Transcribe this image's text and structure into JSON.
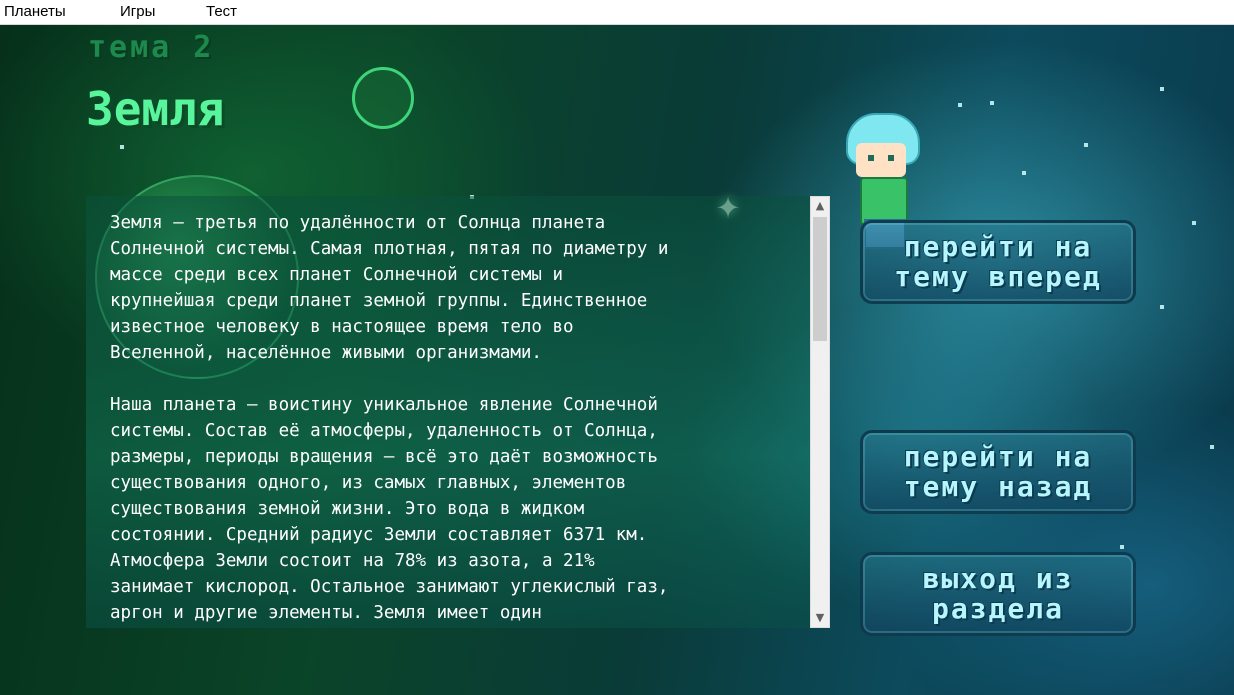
{
  "menu": {
    "items": [
      {
        "label": "Планеты"
      },
      {
        "label": "Игры"
      },
      {
        "label": "Тест"
      }
    ]
  },
  "header": {
    "topic_label": "тема 2",
    "title": "Земля"
  },
  "content": {
    "text": "Земля — третья по удалённости от Солнца планета\nСолнечной системы. Самая плотная, пятая по диаметру и\nмассе среди всех планет Солнечной системы и\nкрупнейшая среди планет земной группы. Единственное\nизвестное человеку в настоящее время тело во\nВселенной, населённое живыми организмами.\n\nНаша планета – воистину уникальное явление Солнечной\nсистемы. Состав её атмосферы, удаленность от Солнца,\nразмеры, периоды вращения – всё это даёт возможность\nсуществования одного, из самых главных, элементов\nсуществования земной жизни. Это вода в жидком\nсостоянии. Средний радиус Земли составляет 6371 км.\nАтмосфера Земли состоит на 78% из азота, а 21%\nзанимает кислород. Остальное занимают углекислый газ,\nаргон и другие элементы. Земля имеет один"
  },
  "buttons": {
    "next": "перейти на\nтему вперед",
    "prev": "перейти на\nтему назад",
    "exit": "выход из\nраздела"
  },
  "scrollbar": {
    "up_arrow": "▲",
    "down_arrow": "▼"
  },
  "colors": {
    "title": "#59f59c",
    "button_text": "#b6f6ff",
    "text": "#ffffff"
  }
}
